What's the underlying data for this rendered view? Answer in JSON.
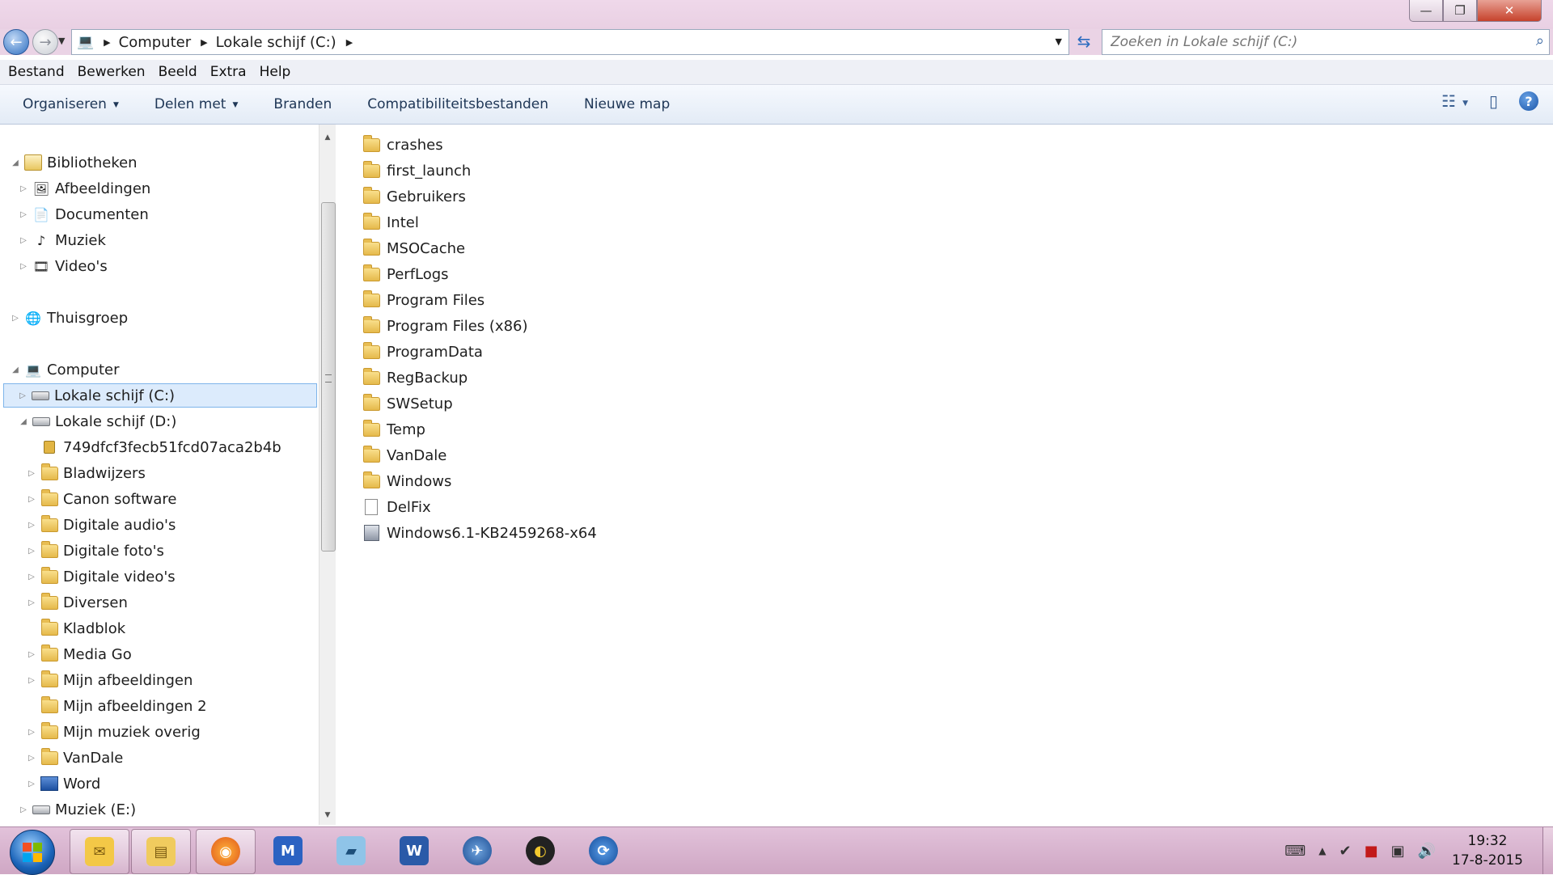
{
  "window": {
    "controls": {
      "minimize": "—",
      "maximize": "❐",
      "close": "✕"
    }
  },
  "address": {
    "crumbs": [
      "Computer",
      "Lokale schijf (C:)"
    ],
    "search_placeholder": "Zoeken in Lokale schijf (C:)"
  },
  "menu": [
    "Bestand",
    "Bewerken",
    "Beeld",
    "Extra",
    "Help"
  ],
  "toolbar": {
    "organize": "Organiseren",
    "share": "Delen met",
    "burn": "Branden",
    "compat": "Compatibiliteitsbestanden",
    "new_folder": "Nieuwe map"
  },
  "nav": {
    "libraries": "Bibliotheken",
    "lib_items": [
      "Afbeeldingen",
      "Documenten",
      "Muziek",
      "Video's"
    ],
    "homegroup": "Thuisgroep",
    "computer": "Computer",
    "drive_c": "Lokale schijf (C:)",
    "drive_d": "Lokale schijf (D:)",
    "d_items": [
      "749dfcf3fecb51fcd07aca2b4b",
      "Bladwijzers",
      "Canon software",
      "Digitale audio's",
      "Digitale foto's",
      "Digitale video's",
      "Diversen",
      "Kladblok",
      "Media Go",
      "Mijn afbeeldingen",
      "Mijn afbeeldingen 2",
      "Mijn muziek overig",
      "VanDale",
      "Word"
    ],
    "drive_e": "Muziek (E:)"
  },
  "files": [
    "crashes",
    "first_launch",
    "Gebruikers",
    "Intel",
    "MSOCache",
    "PerfLogs",
    "Program Files",
    "Program Files (x86)",
    "ProgramData",
    "RegBackup",
    "SWSetup",
    "Temp",
    "VanDale",
    "Windows",
    "DelFix",
    "Windows6.1-KB2459268-x64"
  ],
  "taskbar": {
    "time": "19:32",
    "date": "17-8-2015"
  },
  "colors": {
    "accent": "#2f6fc0",
    "selection": "#dcebfc",
    "titlebar": "#ead3e5"
  }
}
